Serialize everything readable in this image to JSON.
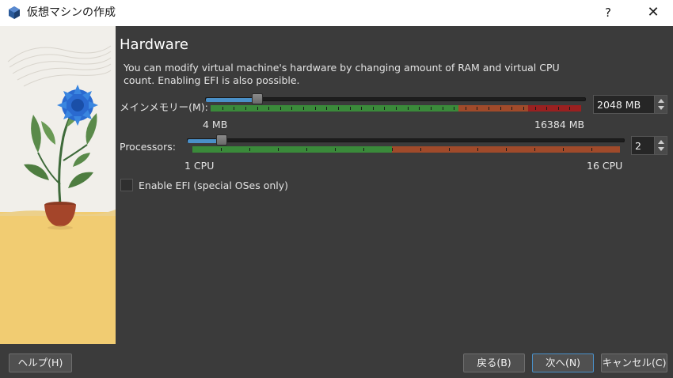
{
  "window": {
    "title": "仮想マシンの作成",
    "help_glyph": "?",
    "close_glyph": "✕"
  },
  "page": {
    "heading": "Hardware",
    "description": "You can modify virtual machine's hardware by changing amount of RAM and virtual CPU count. Enabling EFI is also possible."
  },
  "memory": {
    "label": "メインメモリー(M):",
    "value": "2048 MB",
    "min_label": "4 MB",
    "max_label": "16384 MB",
    "min_mb": 4,
    "max_mb": 16384,
    "current_mb": 2048
  },
  "processors": {
    "label": "Processors:",
    "value": "2",
    "min_label": "1 CPU",
    "max_label": "16 CPU",
    "min": 1,
    "max": 16,
    "current": 2
  },
  "efi": {
    "label": "Enable EFI (special OSes only)",
    "checked": false
  },
  "buttons": {
    "help": "ヘルプ(H)",
    "back": "戻る(B)",
    "next": "次へ(N)",
    "cancel": "キャンセル(C)"
  },
  "colors": {
    "ok": "#3a8a3a",
    "warn": "#a04a2a",
    "bad": "#9a2020",
    "accent": "#4a90c8"
  }
}
